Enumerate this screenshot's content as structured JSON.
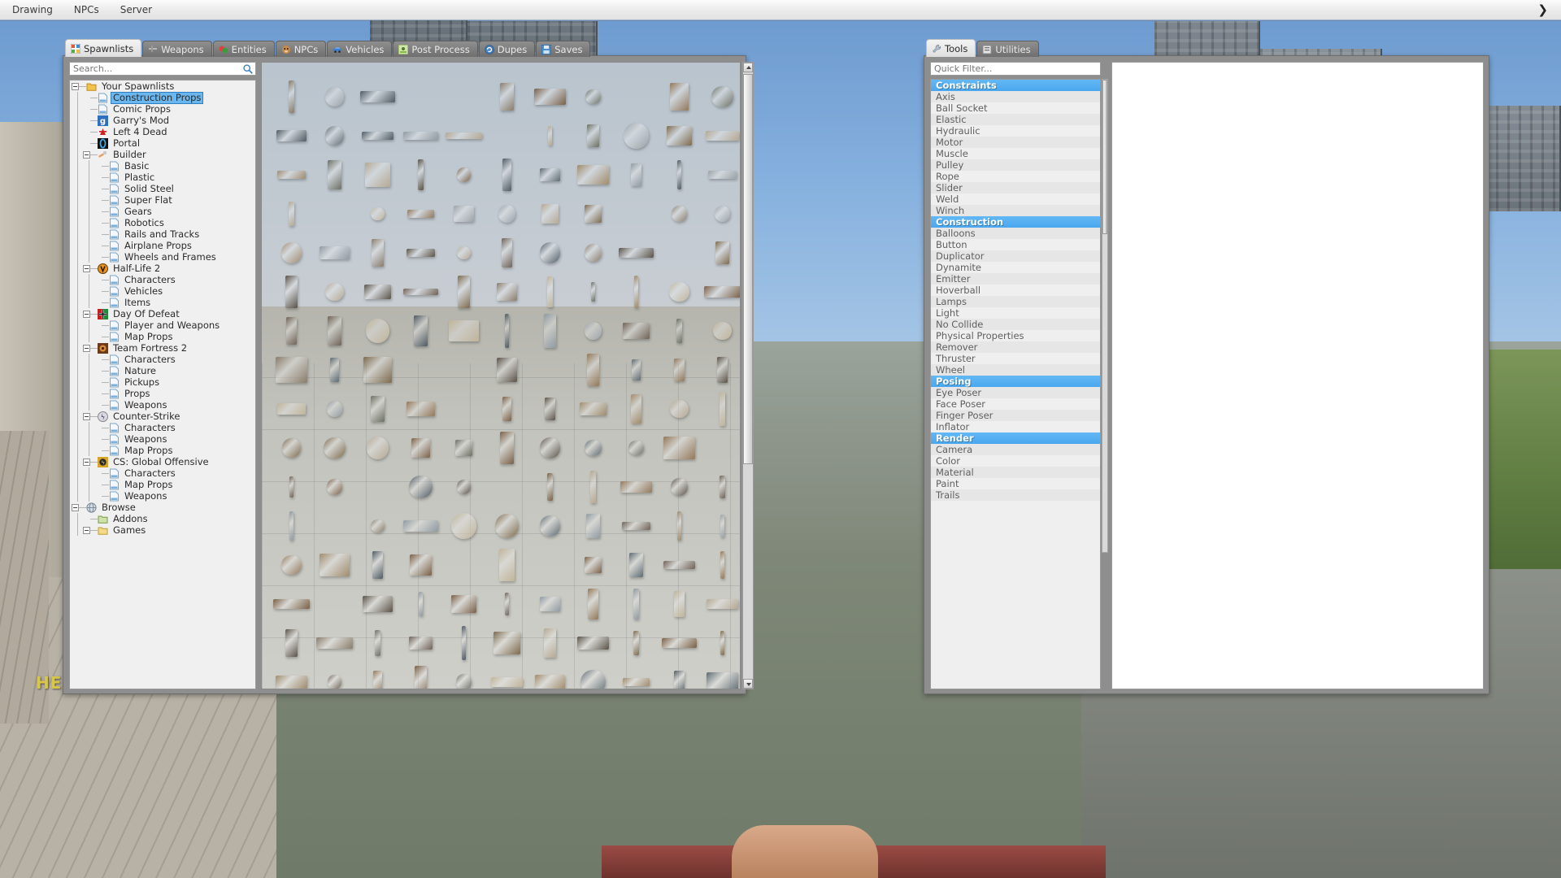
{
  "menubar": {
    "items": [
      {
        "label": "Drawing",
        "name": "menu-drawing"
      },
      {
        "label": "NPCs",
        "name": "menu-npcs"
      },
      {
        "label": "Server",
        "name": "menu-server"
      }
    ],
    "collapse_glyph": "❯"
  },
  "hud": {
    "health_label": "HEA"
  },
  "spawnmenu": {
    "tabs": [
      {
        "label": "Spawnlists",
        "icon": "grid-icon",
        "active": true
      },
      {
        "label": "Weapons",
        "icon": "weapon-icon",
        "active": false
      },
      {
        "label": "Entities",
        "icon": "entities-icon",
        "active": false
      },
      {
        "label": "NPCs",
        "icon": "npc-icon",
        "active": false
      },
      {
        "label": "Vehicles",
        "icon": "vehicle-icon",
        "active": false
      },
      {
        "label": "Post Process",
        "icon": "postprocess-icon",
        "active": false
      },
      {
        "label": "Dupes",
        "icon": "dupes-icon",
        "active": false
      },
      {
        "label": "Saves",
        "icon": "saves-icon",
        "active": false
      }
    ],
    "search": {
      "value": "",
      "placeholder": "Search..."
    },
    "tree": [
      {
        "label": "Your Spawnlists",
        "depth": 0,
        "icon": "folder",
        "expander": true,
        "selected": false
      },
      {
        "label": "Construction Props",
        "depth": 1,
        "icon": "doc",
        "expander": false,
        "selected": true
      },
      {
        "label": "Comic Props",
        "depth": 1,
        "icon": "doc",
        "expander": false,
        "selected": false
      },
      {
        "label": "Garry's Mod",
        "depth": 1,
        "icon": "gmod",
        "expander": false,
        "selected": false
      },
      {
        "label": "Left 4 Dead",
        "depth": 1,
        "icon": "l4d",
        "expander": false,
        "selected": false
      },
      {
        "label": "Portal",
        "depth": 1,
        "icon": "portal",
        "expander": false,
        "selected": false
      },
      {
        "label": "Builder",
        "depth": 1,
        "icon": "builder",
        "expander": true,
        "selected": false
      },
      {
        "label": "Basic",
        "depth": 2,
        "icon": "doc",
        "expander": false,
        "selected": false
      },
      {
        "label": "Plastic",
        "depth": 2,
        "icon": "doc",
        "expander": false,
        "selected": false
      },
      {
        "label": "Solid Steel",
        "depth": 2,
        "icon": "doc",
        "expander": false,
        "selected": false
      },
      {
        "label": "Super Flat",
        "depth": 2,
        "icon": "doc",
        "expander": false,
        "selected": false
      },
      {
        "label": "Gears",
        "depth": 2,
        "icon": "doc",
        "expander": false,
        "selected": false
      },
      {
        "label": "Robotics",
        "depth": 2,
        "icon": "doc",
        "expander": false,
        "selected": false
      },
      {
        "label": "Rails and Tracks",
        "depth": 2,
        "icon": "doc",
        "expander": false,
        "selected": false
      },
      {
        "label": "Airplane Props",
        "depth": 2,
        "icon": "doc",
        "expander": false,
        "selected": false
      },
      {
        "label": "Wheels and Frames",
        "depth": 2,
        "icon": "doc",
        "expander": false,
        "selected": false
      },
      {
        "label": "Half-Life 2",
        "depth": 1,
        "icon": "hl2",
        "expander": true,
        "selected": false
      },
      {
        "label": "Characters",
        "depth": 2,
        "icon": "doc",
        "expander": false,
        "selected": false
      },
      {
        "label": "Vehicles",
        "depth": 2,
        "icon": "doc",
        "expander": false,
        "selected": false
      },
      {
        "label": "Items",
        "depth": 2,
        "icon": "doc",
        "expander": false,
        "selected": false
      },
      {
        "label": "Day Of Defeat",
        "depth": 1,
        "icon": "dod",
        "expander": true,
        "selected": false
      },
      {
        "label": "Player and Weapons",
        "depth": 2,
        "icon": "doc",
        "expander": false,
        "selected": false
      },
      {
        "label": "Map Props",
        "depth": 2,
        "icon": "doc",
        "expander": false,
        "selected": false
      },
      {
        "label": "Team Fortress 2",
        "depth": 1,
        "icon": "tf2",
        "expander": true,
        "selected": false
      },
      {
        "label": "Characters",
        "depth": 2,
        "icon": "doc",
        "expander": false,
        "selected": false
      },
      {
        "label": "Nature",
        "depth": 2,
        "icon": "doc",
        "expander": false,
        "selected": false
      },
      {
        "label": "Pickups",
        "depth": 2,
        "icon": "doc",
        "expander": false,
        "selected": false
      },
      {
        "label": "Props",
        "depth": 2,
        "icon": "doc",
        "expander": false,
        "selected": false
      },
      {
        "label": "Weapons",
        "depth": 2,
        "icon": "doc",
        "expander": false,
        "selected": false
      },
      {
        "label": "Counter-Strike",
        "depth": 1,
        "icon": "cs",
        "expander": true,
        "selected": false
      },
      {
        "label": "Characters",
        "depth": 2,
        "icon": "doc",
        "expander": false,
        "selected": false
      },
      {
        "label": "Weapons",
        "depth": 2,
        "icon": "doc",
        "expander": false,
        "selected": false
      },
      {
        "label": "Map Props",
        "depth": 2,
        "icon": "doc",
        "expander": false,
        "selected": false
      },
      {
        "label": "CS: Global Offensive",
        "depth": 1,
        "icon": "csgo",
        "expander": true,
        "selected": false
      },
      {
        "label": "Characters",
        "depth": 2,
        "icon": "doc",
        "expander": false,
        "selected": false
      },
      {
        "label": "Map Props",
        "depth": 2,
        "icon": "doc",
        "expander": false,
        "selected": false
      },
      {
        "label": "Weapons",
        "depth": 2,
        "icon": "doc",
        "expander": false,
        "selected": false
      },
      {
        "label": "Browse",
        "depth": 0,
        "icon": "browse",
        "expander": true,
        "selected": false
      },
      {
        "label": "Addons",
        "depth": 1,
        "icon": "addons",
        "expander": false,
        "selected": false
      },
      {
        "label": "Games",
        "depth": 1,
        "icon": "games",
        "expander": true,
        "selected": false
      }
    ],
    "scrollbar": {
      "name": "spawnlist-scrollbar"
    }
  },
  "toolspanel": {
    "tabs": [
      {
        "label": "Tools",
        "icon": "wrench-icon",
        "active": true
      },
      {
        "label": "Utilities",
        "icon": "utilities-icon",
        "active": false
      }
    ],
    "quick_filter": {
      "value": "",
      "placeholder": "Quick Filter..."
    },
    "sections": [
      {
        "header": "Constraints",
        "items": [
          "Axis",
          "Ball Socket",
          "Elastic",
          "Hydraulic",
          "Motor",
          "Muscle",
          "Pulley",
          "Rope",
          "Slider",
          "Weld",
          "Winch"
        ]
      },
      {
        "header": "Construction",
        "items": [
          "Balloons",
          "Button",
          "Duplicator",
          "Dynamite",
          "Emitter",
          "Hoverball",
          "Lamps",
          "Light",
          "No Collide",
          "Physical Properties",
          "Remover",
          "Thruster",
          "Wheel"
        ]
      },
      {
        "header": "Posing",
        "items": [
          "Eye Poser",
          "Face Poser",
          "Finger Poser",
          "Inflator"
        ]
      },
      {
        "header": "Render",
        "items": [
          "Camera",
          "Color",
          "Material",
          "Paint",
          "Trails"
        ]
      }
    ]
  },
  "colors": {
    "accent": "#4aa7ee",
    "selection": "#6ab6ef",
    "panel_bg": "#8e8e8e",
    "list_bg": "#efefef",
    "tab_active_bg": "#f4f4f4",
    "health_text": "#d8c64a"
  }
}
